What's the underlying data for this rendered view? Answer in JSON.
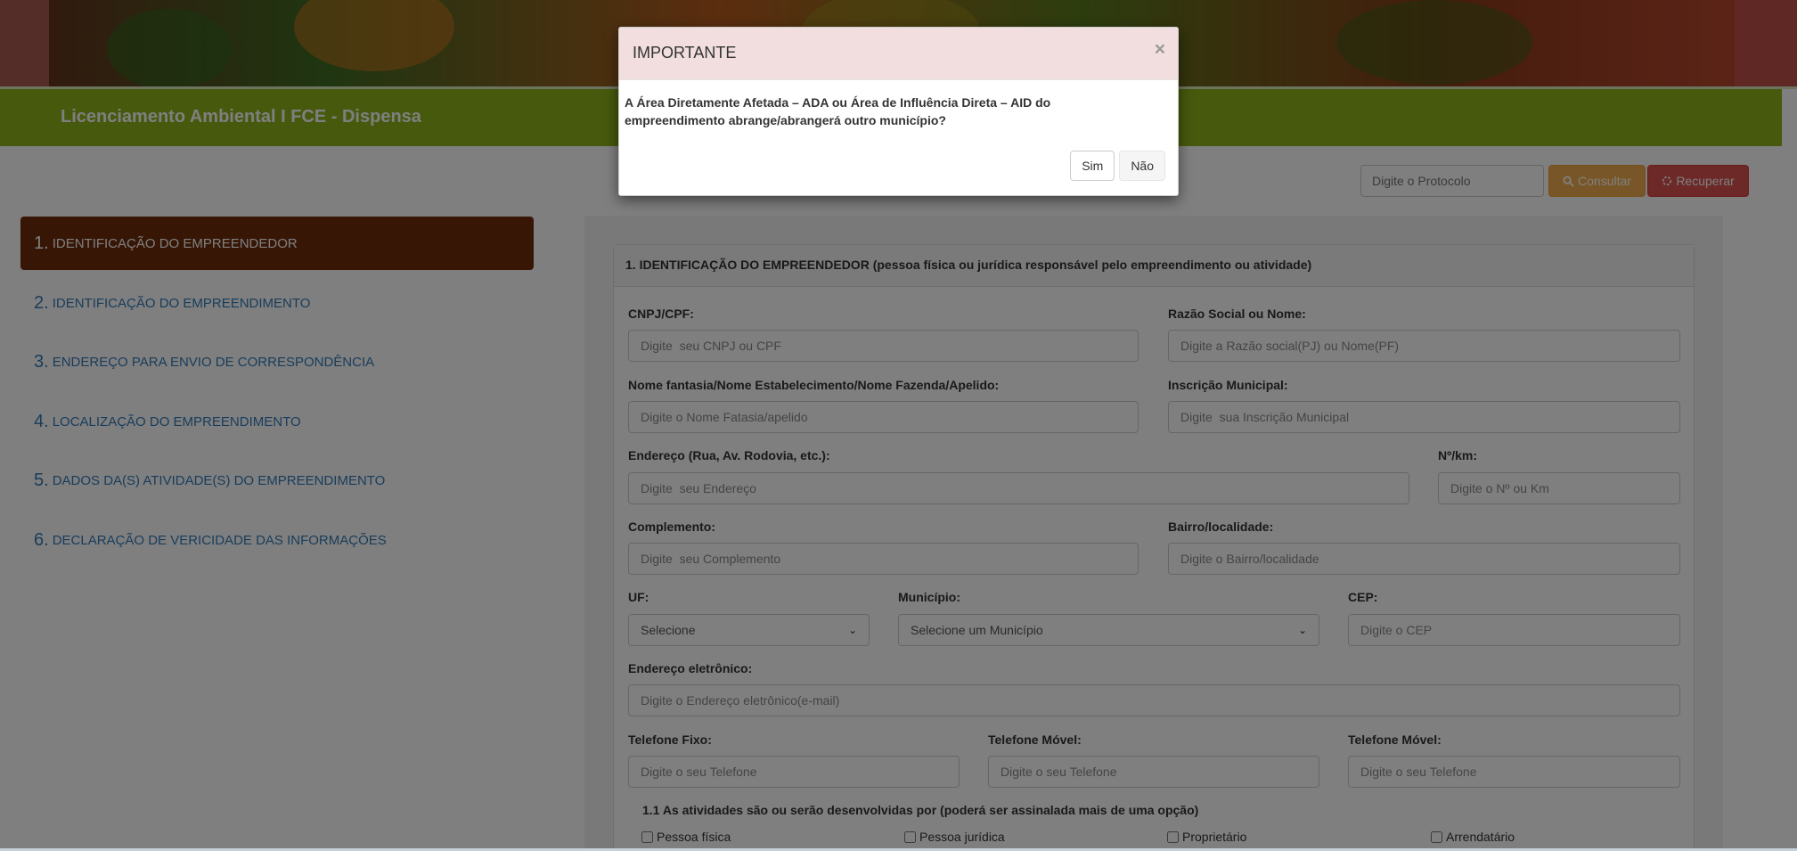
{
  "header": {
    "app_title": "Licenciamento Ambiental I FCE - Dispensa"
  },
  "toolbar": {
    "protocol_placeholder": "Digite o Protocolo",
    "consultar_label": "Consultar",
    "recuperar_label": "Recuperar"
  },
  "sidebar": {
    "steps": [
      {
        "num": "1.",
        "label": "IDENTIFICAÇÃO DO EMPREENDEDOR",
        "active": true
      },
      {
        "num": "2.",
        "label": "IDENTIFICAÇÃO DO EMPREENDIMENTO"
      },
      {
        "num": "3.",
        "label": "ENDEREÇO PARA ENVIO DE CORRESPONDÊNCIA"
      },
      {
        "num": "4.",
        "label": "LOCALIZAÇÃO DO EMPREENDIMENTO"
      },
      {
        "num": "5.",
        "label": "DADOS DA(S) ATIVIDADE(S) DO EMPREENDIMENTO"
      },
      {
        "num": "6.",
        "label": "DECLARAÇÃO DE VERICIDADE DAS INFORMAÇÕES"
      }
    ]
  },
  "form": {
    "heading": "1. IDENTIFICAÇÃO DO EMPREENDEDOR (pessoa física ou jurídica responsável pelo empreendimento ou atividade)",
    "cnpj": {
      "label": "CNPJ/CPF:",
      "placeholder": "Digite  seu CNPJ ou CPF"
    },
    "razao": {
      "label": "Razão Social ou Nome:",
      "placeholder": "Digite a Razão social(PJ) ou Nome(PF)"
    },
    "fantasia": {
      "label": "Nome fantasia/Nome Estabelecimento/Nome Fazenda/Apelido:",
      "placeholder": "Digite o Nome Fatasia/apelido"
    },
    "inscricao": {
      "label": "Inscrição Municipal:",
      "placeholder": "Digite  sua Inscrição Municipal"
    },
    "endereco": {
      "label": "Endereço (Rua, Av. Rodovia, etc.):",
      "placeholder": "Digite  seu Endereço"
    },
    "numero": {
      "label": "Nº/km:",
      "placeholder": "Digite o Nº ou Km"
    },
    "complemento": {
      "label": "Complemento:",
      "placeholder": "Digite  seu Complemento"
    },
    "bairro": {
      "label": "Bairro/localidade:",
      "placeholder": "Digite o Bairro/localidade"
    },
    "uf": {
      "label": "UF:",
      "value": "Selecione"
    },
    "municipio": {
      "label": "Município:",
      "value": "Selecione um Município"
    },
    "cep": {
      "label": "CEP:",
      "placeholder": "Digite o CEP"
    },
    "email": {
      "label": "Endereço eletrônico:",
      "placeholder": "Digite o Endereço eletrônico(e-mail)"
    },
    "tel_fixo": {
      "label": "Telefone Fixo:",
      "placeholder": "Digite o seu Telefone"
    },
    "tel_movel1": {
      "label": "Telefone Móvel:",
      "placeholder": "Digite o seu Telefone"
    },
    "tel_movel2": {
      "label": "Telefone Móvel:",
      "placeholder": "Digite o seu Telefone"
    },
    "activities_question": "1.1 As atividades são ou serão desenvolvidas por (poderá ser assinalada mais de uma opção)",
    "options": [
      "Pessoa física",
      "Pessoa jurídica",
      "Proprietário",
      "Arrendatário"
    ]
  },
  "modal": {
    "title": "IMPORTANTE",
    "close_symbol": "×",
    "body": "A Área Diretamente Afetada – ADA ou Área de Influência Direta – AID do empreendimento abrange/abrangerá outro município?",
    "yes_label": "Sim",
    "no_label": "Não"
  },
  "icons": {
    "search": "search-icon",
    "refresh": "refresh-icon",
    "close": "close-icon",
    "chevron": "chevron-down-icon"
  }
}
